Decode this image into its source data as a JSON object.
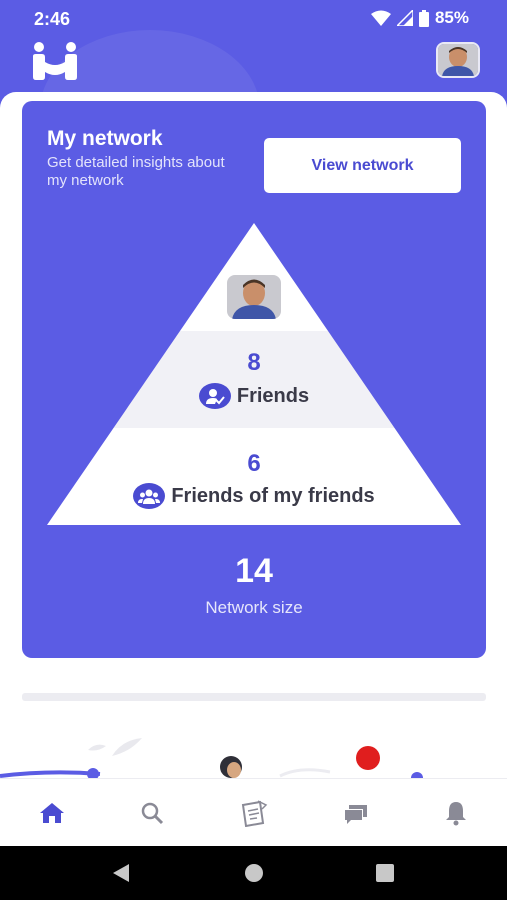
{
  "status_bar": {
    "time": "2:46",
    "battery": "85%",
    "icons": [
      "wifi-icon",
      "signal-icon",
      "battery-icon"
    ]
  },
  "header": {
    "logo_icon": "app-logo-icon",
    "avatar": "profile-avatar"
  },
  "network_card": {
    "title": "My network",
    "subtitle": "Get detailed insights about my network",
    "view_button": "View network",
    "friends": {
      "count": "8",
      "label": "Friends",
      "icon": "user-check-icon"
    },
    "friends_of_friends": {
      "count": "6",
      "label": "Friends of my friends",
      "icon": "group-icon"
    },
    "network_size": {
      "value": "14",
      "label": "Network size"
    }
  },
  "bottom_nav": {
    "items": [
      {
        "name": "home",
        "icon": "home-icon",
        "active": true
      },
      {
        "name": "search",
        "icon": "search-icon",
        "active": false
      },
      {
        "name": "notes",
        "icon": "notes-icon",
        "active": false
      },
      {
        "name": "messages",
        "icon": "chat-icon",
        "active": false
      },
      {
        "name": "notifications",
        "icon": "bell-icon",
        "active": false
      }
    ]
  },
  "colors": {
    "primary": "#5b5ce4",
    "primary_dark": "#4a4bd1",
    "text_dark": "#3a3a48",
    "muted_icon": "#8a8a96",
    "accent_red": "#e01e1e"
  }
}
